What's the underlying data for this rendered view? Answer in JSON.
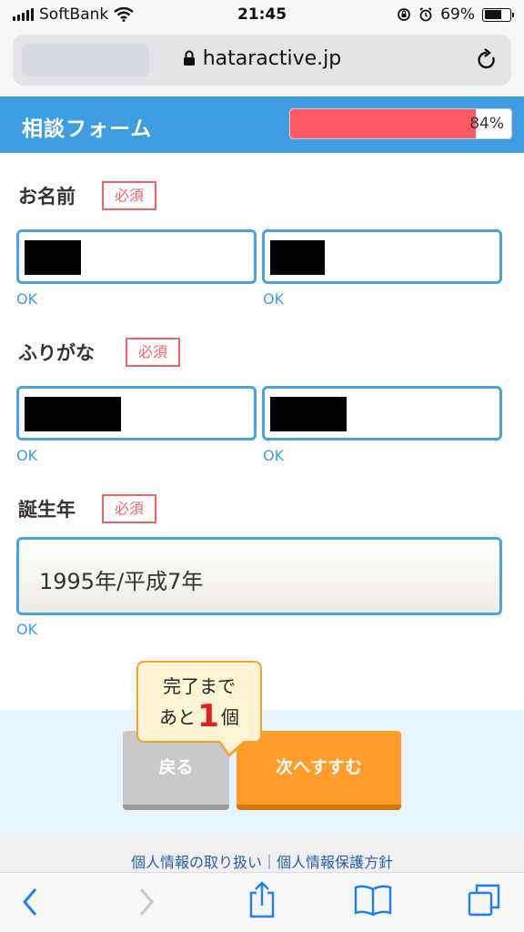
{
  "status": {
    "carrier": "SoftBank",
    "time": "21:45",
    "battery": "69%",
    "battery_level": 0.69
  },
  "browser": {
    "url": "hataractive.jp"
  },
  "form": {
    "title": "相談フォーム",
    "progress_label": "84%",
    "progress": 0.84,
    "required_badge": "必須",
    "name": {
      "label": "お名前",
      "status_first": "OK",
      "status_last": "OK"
    },
    "furigana": {
      "label": "ふりがな",
      "status_first": "OK",
      "status_last": "OK"
    },
    "birth": {
      "label": "誕生年",
      "value": "1995年/平成7年",
      "status": "OK"
    }
  },
  "hint": {
    "line1": "完了まで",
    "prefix": "あと",
    "count": "1",
    "suffix": "個"
  },
  "buttons": {
    "back": "戻る",
    "next": "次へすすむ"
  },
  "footer": {
    "privacy": "個人情報の取り扱い｜個人情報保護方針"
  },
  "colors": {
    "accent": "#3d9de0",
    "progress": "#ff5a64",
    "next": "#ff9c2a",
    "required": "#f2626b"
  }
}
